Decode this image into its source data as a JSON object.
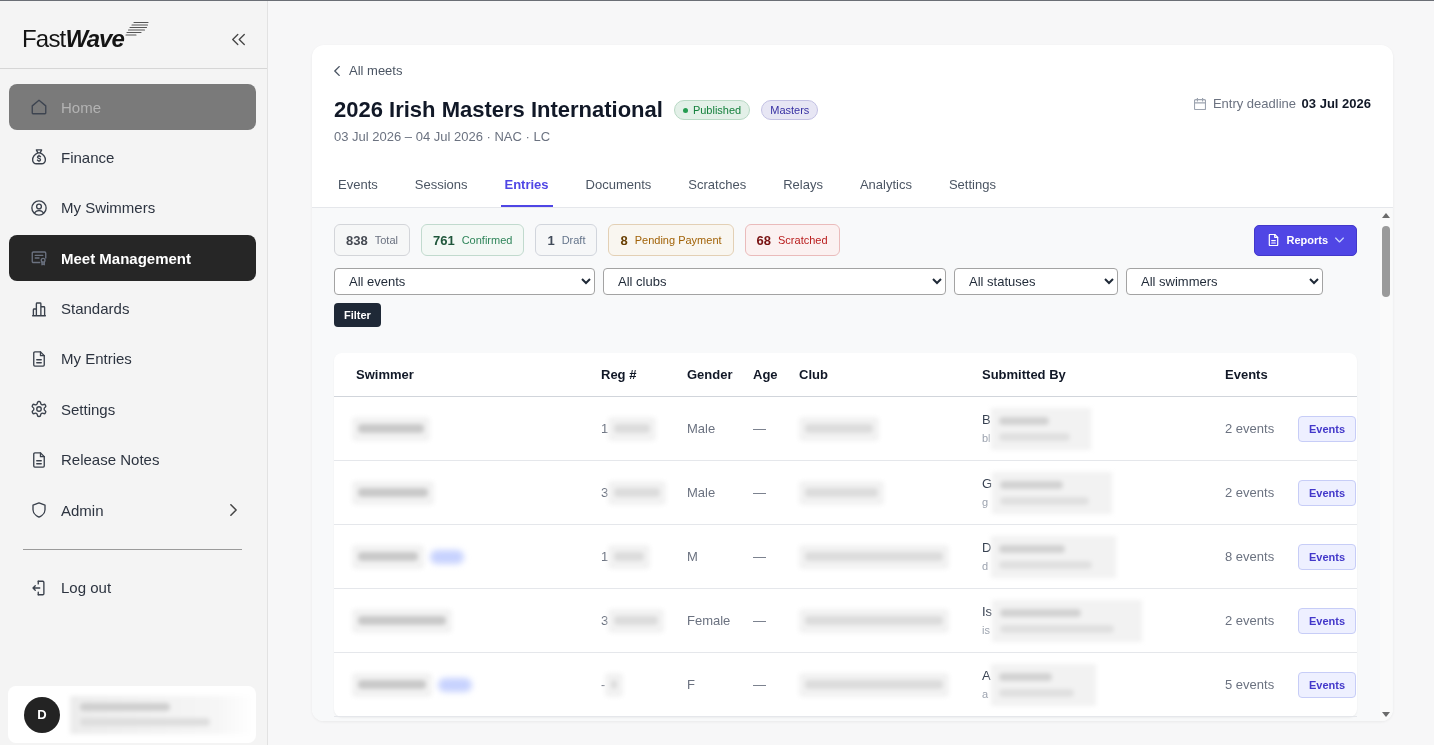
{
  "sidebar": {
    "logo": {
      "regular": "Fast",
      "emphasis": "Wave"
    },
    "items": [
      {
        "label": "Home",
        "selected": false,
        "hovered": true,
        "submenu": false
      },
      {
        "label": "Finance",
        "selected": false,
        "hovered": false,
        "submenu": false
      },
      {
        "label": "My Swimmers",
        "selected": false,
        "hovered": false,
        "submenu": false
      },
      {
        "label": "Meet Management",
        "selected": true,
        "hovered": false,
        "submenu": false
      },
      {
        "label": "Standards",
        "selected": false,
        "hovered": false,
        "submenu": false
      },
      {
        "label": "My Entries",
        "selected": false,
        "hovered": false,
        "submenu": false
      },
      {
        "label": "Settings",
        "selected": false,
        "hovered": false,
        "submenu": false
      },
      {
        "label": "Release Notes",
        "selected": false,
        "hovered": false,
        "submenu": false
      },
      {
        "label": "Admin",
        "selected": false,
        "hovered": false,
        "submenu": true
      }
    ],
    "logout": "Log out",
    "user": {
      "initial": "D"
    }
  },
  "meet": {
    "back_link": "All meets",
    "title": "2026 Irish Masters International",
    "badges": [
      {
        "label": "Published",
        "color": "#15803d",
        "dot": true
      },
      {
        "label": "Masters",
        "color": "#3730a3",
        "dot": false
      }
    ],
    "subtitle": "03 Jul 2026 – 04 Jul 2026 · NAC · LC",
    "deadline": "Entry deadline **03 Jul 2026**",
    "tabs": [
      {
        "label": "Events",
        "selected": false
      },
      {
        "label": "Sessions",
        "selected": false
      },
      {
        "label": "Entries",
        "selected": true
      },
      {
        "label": "Documents",
        "selected": false
      },
      {
        "label": "Scratches",
        "selected": false
      },
      {
        "label": "Relays",
        "selected": false
      },
      {
        "label": "Analytics",
        "selected": false
      },
      {
        "label": "Settings",
        "selected": false
      }
    ]
  },
  "entries": {
    "stats": [
      {
        "count": "838",
        "label": "Total",
        "color": "#6b7280"
      },
      {
        "count": "761",
        "label": "Confirmed",
        "color": "#2f855a"
      },
      {
        "count": "1",
        "label": "Draft",
        "color": "#64748b"
      },
      {
        "count": "8",
        "label": "Pending Payment",
        "color": "#a16207"
      },
      {
        "count": "68",
        "label": "Scratched",
        "color": "#b91c1c"
      }
    ],
    "reports_button": "Reports",
    "filters": [
      "All events",
      "All clubs",
      "All statuses",
      "All swimmers"
    ],
    "filter_button": "Filter",
    "table": {
      "columns": [
        "Swimmer",
        "Reg #",
        "Gender",
        "Age",
        "Club",
        "Submitted By",
        "Events"
      ],
      "rows": [
        {
          "tagged": false,
          "reg_no": "1",
          "gender": "Male",
          "age": "—",
          "submitted_by_name": "B",
          "submitted_by_email": "bl",
          "events": "2 events",
          "action": "Events"
        },
        {
          "tagged": false,
          "reg_no": "3",
          "gender": "Male",
          "age": "—",
          "submitted_by_name": "G",
          "submitted_by_email": "g",
          "events": "2 events",
          "action": "Events"
        },
        {
          "tagged": true,
          "reg_no": "1",
          "gender": "M",
          "age": "—",
          "submitted_by_name": "D",
          "submitted_by_email": "d",
          "events": "8 events",
          "action": "Events"
        },
        {
          "tagged": false,
          "reg_no": "3",
          "gender": "Female",
          "age": "—",
          "submitted_by_name": "Is",
          "submitted_by_email": "is",
          "events": "2 events",
          "action": "Events"
        },
        {
          "tagged": true,
          "reg_no": "-",
          "gender": "F",
          "age": "—",
          "submitted_by_name": "A",
          "submitted_by_email": "a",
          "events": "5 events",
          "action": "Events"
        }
      ]
    }
  }
}
